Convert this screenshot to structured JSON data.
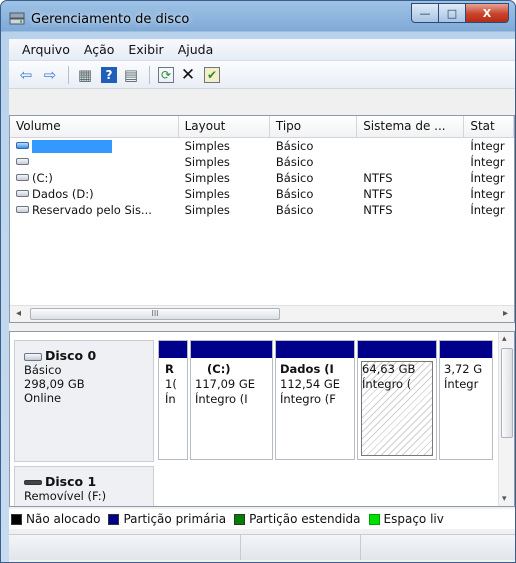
{
  "window": {
    "title": "Gerenciamento de disco",
    "buttons": {
      "minimize": "—",
      "maximize": "□",
      "close": "X"
    }
  },
  "menu": [
    {
      "label": "Arquivo"
    },
    {
      "label": "Ação"
    },
    {
      "label": "Exibir"
    },
    {
      "label": "Ajuda"
    }
  ],
  "toolbar": {
    "icons": [
      "back-arrow-icon",
      "forward-arrow-icon",
      "volume-list-icon",
      "help-icon",
      "properties-icon",
      "refresh-icon",
      "delete-icon",
      "settings-icon"
    ],
    "glyphs": {
      "back": "⇦",
      "forward": "⇨",
      "list": "▦",
      "help": "?",
      "props": "▤",
      "refresh": "⟳",
      "delete": "✕",
      "settings": "✔"
    }
  },
  "volume_table": {
    "columns": [
      "Volume",
      "Layout",
      "Tipo",
      "Sistema de ...",
      "Stat"
    ],
    "rows": [
      {
        "volume": "",
        "layout": "Simples",
        "tipo": "Básico",
        "fs": "",
        "status": "Íntegr"
      },
      {
        "volume": "",
        "layout": "Simples",
        "tipo": "Básico",
        "fs": "",
        "status": "Íntegr"
      },
      {
        "volume": "(C:)",
        "layout": "Simples",
        "tipo": "Básico",
        "fs": "NTFS",
        "status": "Íntegr"
      },
      {
        "volume": "Dados (D:)",
        "layout": "Simples",
        "tipo": "Básico",
        "fs": "NTFS",
        "status": "Íntegr"
      },
      {
        "volume": "Reservado pelo Sis...",
        "layout": "Simples",
        "tipo": "Básico",
        "fs": "NTFS",
        "status": "Íntegr"
      }
    ],
    "scroll": {
      "left": "◂",
      "right": "▸",
      "thumb": "III"
    }
  },
  "disks": [
    {
      "name": "Disco 0",
      "type": "Básico",
      "size": "298,09 GB",
      "state": "Online",
      "partitions": [
        {
          "line1": "R",
          "line2": "1(",
          "line3": "Ín"
        },
        {
          "line1": "(C:)",
          "line2": "117,09 GE",
          "line3": "Íntegro (I"
        },
        {
          "line1": "Dados (I",
          "line2": "112,54 GE",
          "line3": "Íntegro (F"
        },
        {
          "line1": "",
          "line2": "64,63 GB",
          "line3": "Íntegro ("
        },
        {
          "line1": "",
          "line2": "3,72 G",
          "line3": "Íntegr"
        }
      ]
    },
    {
      "name": "Disco 1",
      "type": "Removível (F:)"
    }
  ],
  "legend": [
    {
      "label": "Não alocado",
      "color": "#000000"
    },
    {
      "label": "Partição primária",
      "color": "#00008b"
    },
    {
      "label": "Partição estendida",
      "color": "#008000"
    },
    {
      "label": "Espaço liv",
      "color": "#00e000"
    }
  ],
  "vscroll": {
    "up": "▴",
    "down": "▾"
  }
}
